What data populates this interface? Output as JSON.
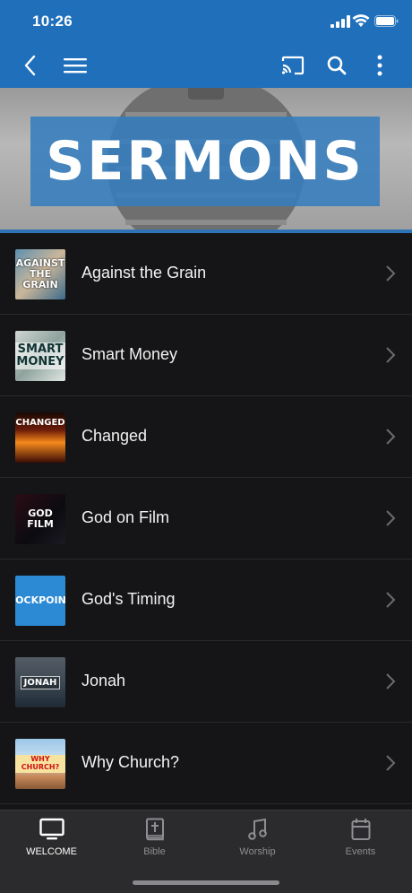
{
  "status_bar": {
    "time": "10:26"
  },
  "hero": {
    "title": "SERMONS"
  },
  "sermons": [
    {
      "title": "Against the Grain",
      "thumb_text": "AGAINST THE GRAIN"
    },
    {
      "title": "Smart Money",
      "thumb_text": "SMART MONEY"
    },
    {
      "title": "Changed",
      "thumb_text": "CHANGED"
    },
    {
      "title": "God on Film",
      "thumb_text": "GOD FILM"
    },
    {
      "title": "God's Timing",
      "thumb_text": "ROCKPOINT"
    },
    {
      "title": "Jonah",
      "thumb_text": "JONAH"
    },
    {
      "title": "Why Church?",
      "thumb_text": "WHY CHURCH?"
    }
  ],
  "tabs": [
    {
      "label": "WELCOME",
      "icon": "tv-icon",
      "active": true
    },
    {
      "label": "Bible",
      "icon": "bible-icon",
      "active": false
    },
    {
      "label": "Worship",
      "icon": "music-note-icon",
      "active": false
    },
    {
      "label": "Events",
      "icon": "calendar-icon",
      "active": false
    }
  ],
  "colors": {
    "header": "#1f6fbb",
    "hero_box": "#357dbe",
    "background": "#151517",
    "tabbar": "#2b2b2d"
  }
}
